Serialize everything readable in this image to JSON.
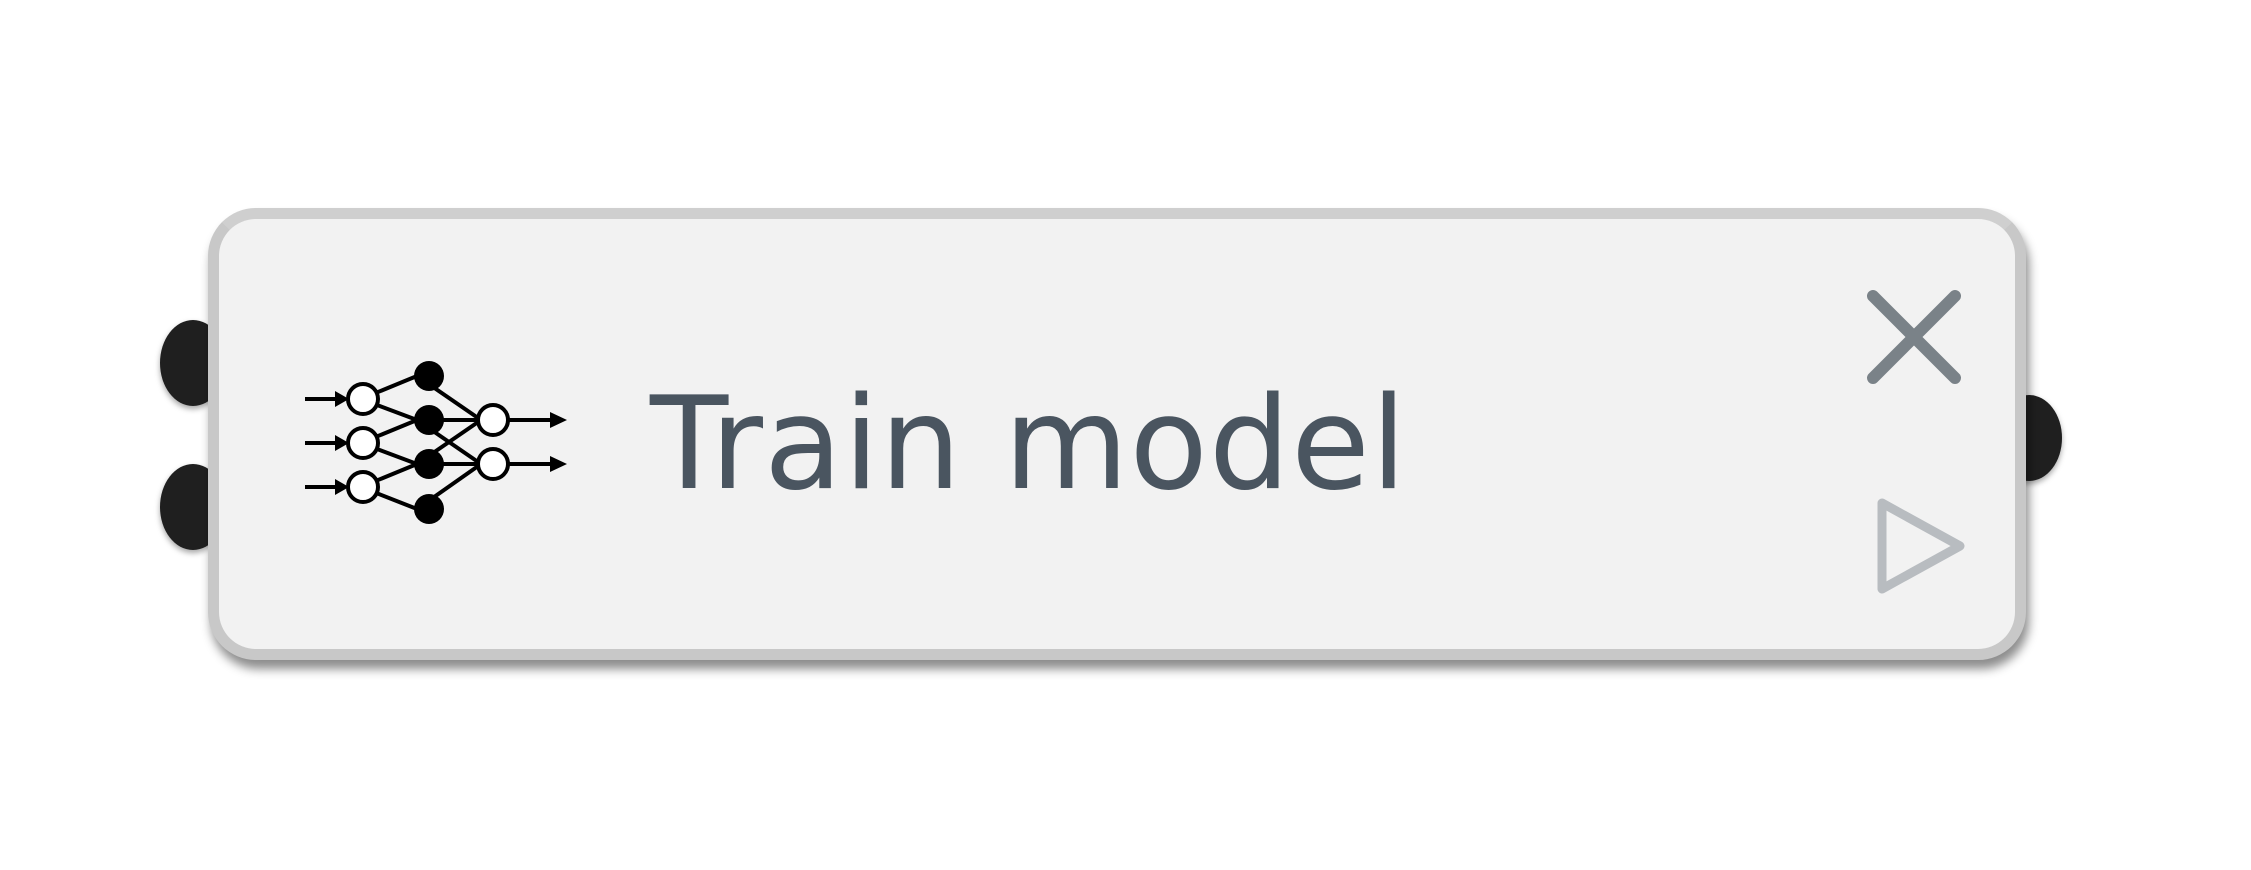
{
  "node": {
    "title": "Train model",
    "icon": "neural-network-icon",
    "actions": {
      "close_icon": "close-icon",
      "run_icon": "play-icon"
    },
    "ports": {
      "inputs": 2,
      "outputs": 1
    }
  },
  "colors": {
    "node_fill": "#f2f2f2",
    "node_border": "#c8c8c8",
    "title_text": "#4a5560",
    "port_fill": "#1f1f1f",
    "close_icon": "#7a8288",
    "play_icon": "#b8bcc0"
  }
}
